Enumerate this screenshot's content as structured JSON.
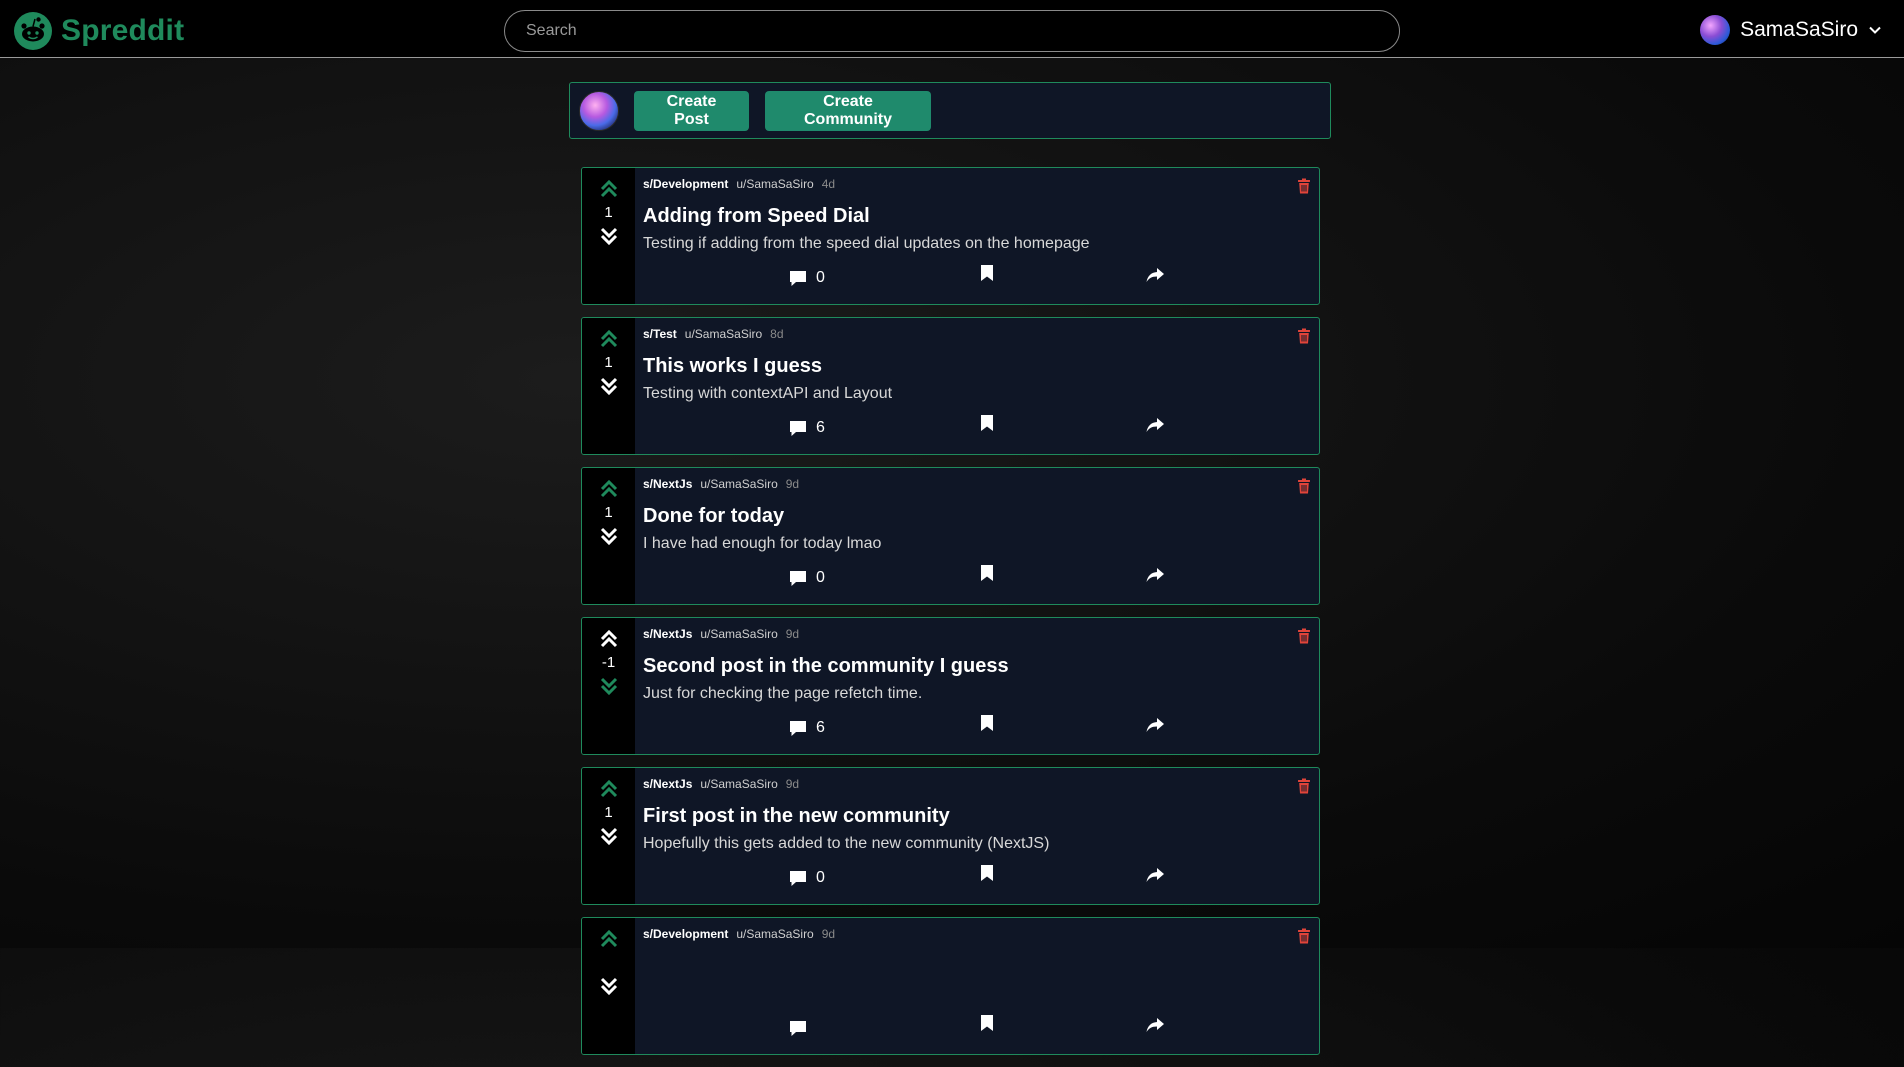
{
  "app": {
    "name": "Spreddit"
  },
  "search": {
    "placeholder": "Search"
  },
  "user": {
    "name": "SamaSaSiro"
  },
  "create": {
    "post_label": "Create Post",
    "community_label": "Create Community"
  },
  "colors": {
    "accent": "#1f8a5c",
    "card_bg": "#0f1626",
    "trash": "#e0443a"
  },
  "posts": [
    {
      "subreddit": "s/Development",
      "author": "u/SamaSaSiro",
      "age": "4d",
      "title": "Adding from Speed Dial",
      "body": "Testing if adding from the speed dial updates on the homepage",
      "score": "1",
      "comments": "0",
      "vote_state": "up"
    },
    {
      "subreddit": "s/Test",
      "author": "u/SamaSaSiro",
      "age": "8d",
      "title": "This works I guess",
      "body": "Testing with contextAPI and Layout",
      "score": "1",
      "comments": "6",
      "vote_state": "up"
    },
    {
      "subreddit": "s/NextJs",
      "author": "u/SamaSaSiro",
      "age": "9d",
      "title": "Done for today",
      "body": "I have had enough for today lmao",
      "score": "1",
      "comments": "0",
      "vote_state": "up"
    },
    {
      "subreddit": "s/NextJs",
      "author": "u/SamaSaSiro",
      "age": "9d",
      "title": "Second post in the community I guess",
      "body": "Just for checking the page refetch time.",
      "score": "-1",
      "comments": "6",
      "vote_state": "down"
    },
    {
      "subreddit": "s/NextJs",
      "author": "u/SamaSaSiro",
      "age": "9d",
      "title": "First post in the new community",
      "body": "Hopefully this gets added to the new community (NextJS)",
      "score": "1",
      "comments": "0",
      "vote_state": "up"
    },
    {
      "subreddit": "s/Development",
      "author": "u/SamaSaSiro",
      "age": "9d",
      "title": "",
      "body": "",
      "score": "",
      "comments": "",
      "vote_state": "up"
    }
  ]
}
